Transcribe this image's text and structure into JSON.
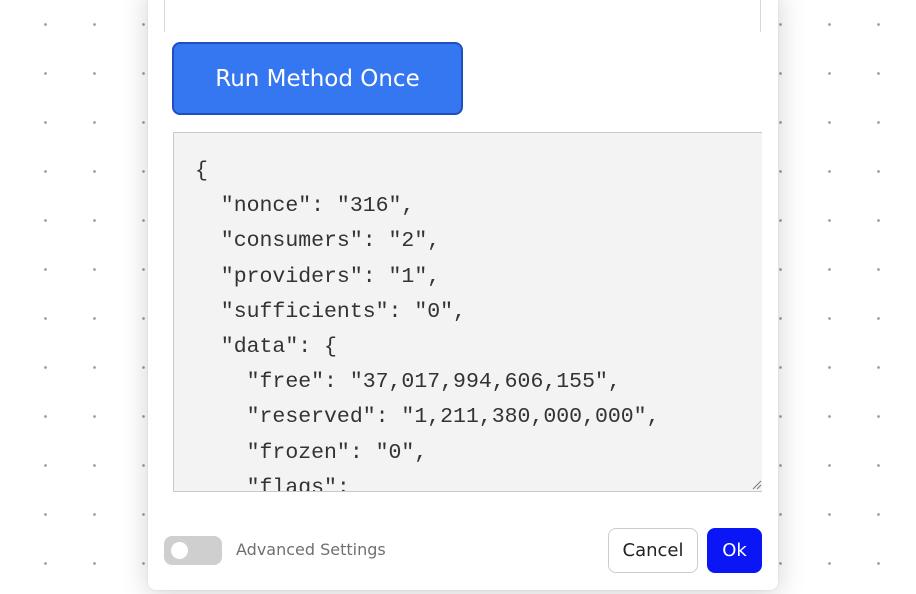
{
  "run_button": {
    "label": "Run Method Once"
  },
  "result": {
    "text": "{\n  \"nonce\": \"316\",\n  \"consumers\": \"2\",\n  \"providers\": \"1\",\n  \"sufficients\": \"0\",\n  \"data\": {\n    \"free\": \"37,017,994,606,155\",\n    \"reserved\": \"1,211,380,000,000\",\n    \"frozen\": \"0\",\n    \"flags\":"
  },
  "footer": {
    "advanced_label": "Advanced Settings",
    "advanced_enabled": false,
    "cancel_label": "Cancel",
    "ok_label": "Ok"
  },
  "colors": {
    "primary": "#3577f1",
    "ok": "#0a16f5",
    "result_bg": "#f3f3f3"
  },
  "icons": {
    "resize": "resize-grip-icon"
  }
}
